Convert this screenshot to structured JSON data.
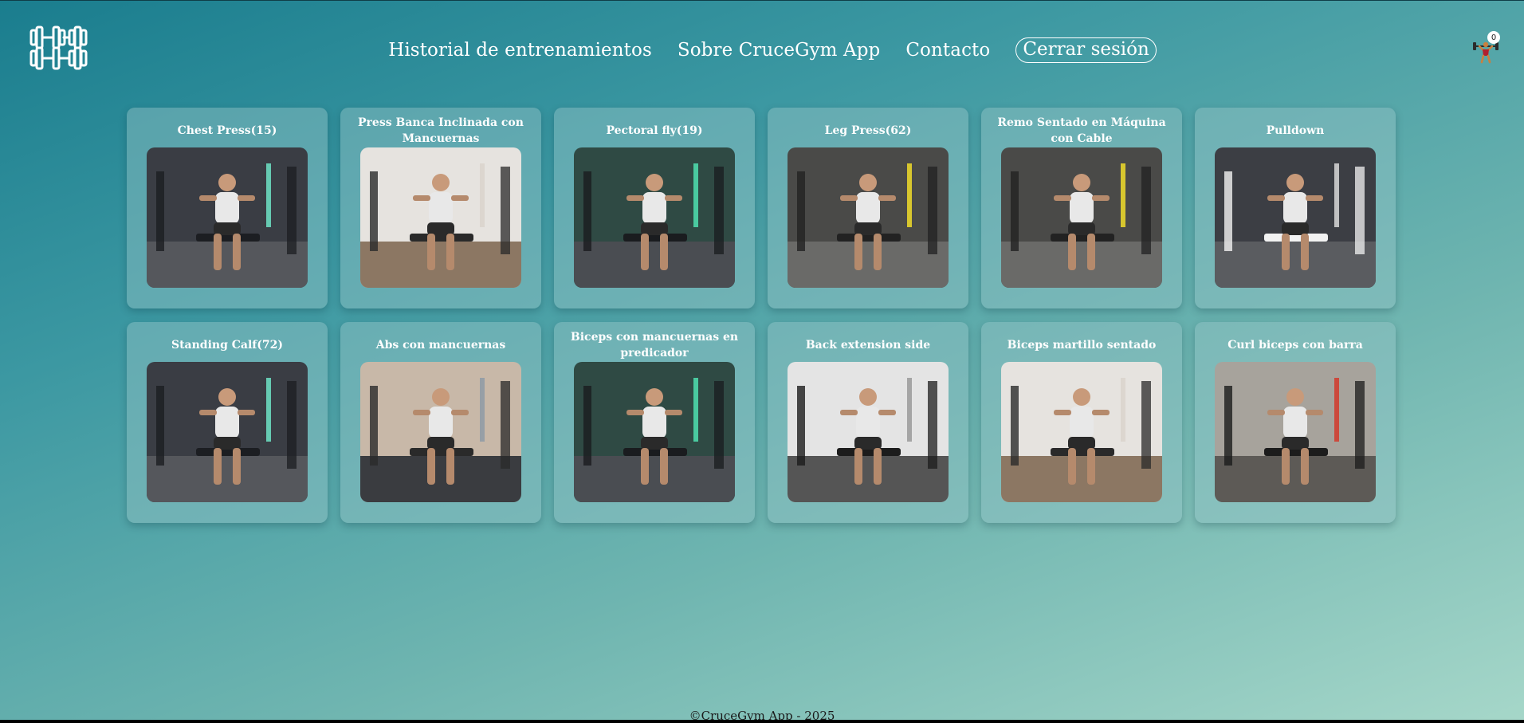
{
  "nav": {
    "items": [
      "Historial de entrenamientos",
      "Sobre CruceGym App",
      "Contacto"
    ],
    "logout": "Cerrar sesión"
  },
  "cart": {
    "count": "0"
  },
  "exercises": [
    {
      "title": "Chest Press(15)",
      "scene": "gym-dark"
    },
    {
      "title": "Press Banca Inclinada con Mancuernas",
      "scene": "studio-light"
    },
    {
      "title": "Pectoral fly(19)",
      "scene": "gym-green"
    },
    {
      "title": "Leg Press(62)",
      "scene": "gym-yellow"
    },
    {
      "title": "Remo Sentado en Máquina con Cable",
      "scene": "gym-yellow"
    },
    {
      "title": "Pulldown",
      "scene": "gym-white"
    },
    {
      "title": "Standing Calf(72)",
      "scene": "gym-dark"
    },
    {
      "title": "Abs con mancuernas",
      "scene": "studio-dark"
    },
    {
      "title": "Biceps con mancuernas en predicador",
      "scene": "gym-green"
    },
    {
      "title": "Back extension side",
      "scene": "studio-grey"
    },
    {
      "title": "Biceps martillo sentado",
      "scene": "studio-light"
    },
    {
      "title": "Curl biceps con barra",
      "scene": "studio-concrete"
    }
  ],
  "footer": {
    "text": "©CruceGym App - 2025"
  },
  "colors": {
    "accent": "#ffffff",
    "bg_start": "#1a7d8e",
    "bg_end": "#a6d7c9"
  }
}
